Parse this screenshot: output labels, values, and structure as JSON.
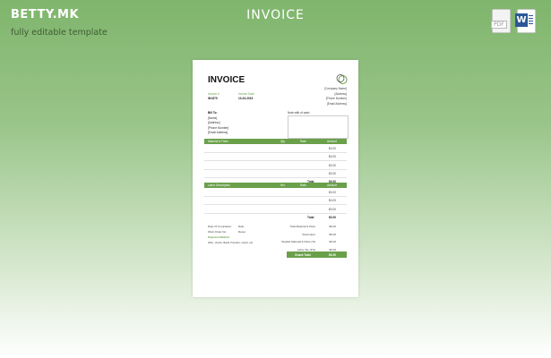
{
  "header": {
    "brand": "BETTY.MK",
    "tagline": "fully editable template",
    "title": "INVOICE",
    "pdf_icon_label": "PDF",
    "word_icon_label": "W"
  },
  "colors": {
    "accent": "#6aa04a",
    "background_top": "#7fb56c"
  },
  "document": {
    "title": "INVOICE",
    "company": [
      "[Company Name]",
      "[Address]",
      "[Phone Number]",
      "[Email Address]"
    ],
    "invoice_label": "Invoice #",
    "invoice_value": "INV875",
    "date_label": "Invoice Date",
    "date_value": "10-03-2019",
    "bill_to_label": "Bill To:",
    "bill_to_lines": [
      "[Name]",
      "[Address]",
      "[Phone Number]",
      "[Email Address]"
    ],
    "paid_label": "Note with of cash",
    "materials": {
      "headers": [
        "Material & Parts",
        "Qty",
        "Rate",
        "Amount"
      ],
      "rows": [
        "$0.00",
        "$0.00",
        "$0.00",
        "$0.00"
      ],
      "total_label": "Total",
      "total_value": "$0.00"
    },
    "labor": {
      "headers": [
        "Labor Description",
        "Hrs",
        "Rate",
        "Amount"
      ],
      "rows": [
        "$0.00",
        "$0.00",
        "$0.00"
      ],
      "total_label": "Total",
      "total_value": "$0.00"
    },
    "terms": [
      {
        "label": "Date Of Completion",
        "value": "Date"
      },
      {
        "label": "Work Order No.",
        "value": "Reset"
      }
    ],
    "payment_label": "Payment Method",
    "payment_value": "Wire, check, Bank Transfer, Cash, etc.",
    "summary": [
      {
        "label": "Total Material & Parts",
        "value": "$0.00"
      },
      {
        "label": "Total Labor",
        "value": "$0.00"
      },
      {
        "label": "Taxable Material & Parts (%)",
        "value": "$0.00"
      },
      {
        "label": "Labor Tax (3%)",
        "value": "$0.00"
      }
    ],
    "grand_total_label": "Grand Total",
    "grand_total_value": "$0.00"
  }
}
